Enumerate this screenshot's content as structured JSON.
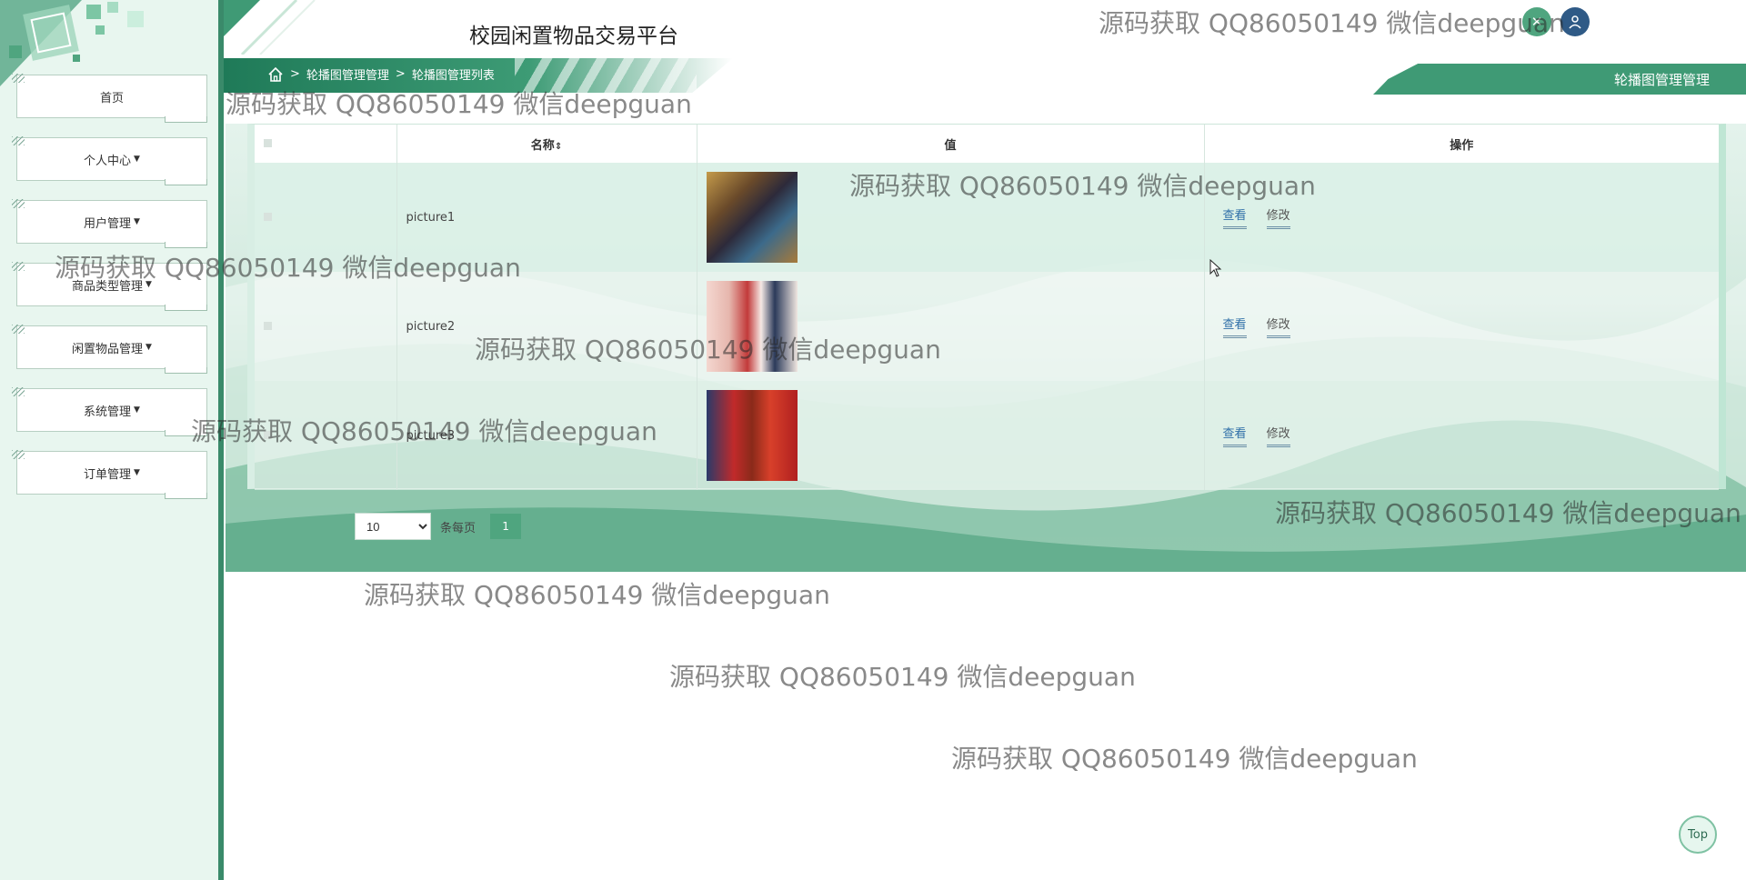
{
  "app": {
    "title": "校园闲置物品交易平台"
  },
  "sidebar": {
    "items": [
      {
        "label": "首页",
        "has_caret": false
      },
      {
        "label": "个人中心",
        "has_caret": true
      },
      {
        "label": "用户管理",
        "has_caret": true
      },
      {
        "label": "商品类型管理",
        "has_caret": true
      },
      {
        "label": "闲置物品管理",
        "has_caret": true
      },
      {
        "label": "系统管理",
        "has_caret": true
      },
      {
        "label": "订单管理",
        "has_caret": true
      }
    ]
  },
  "header": {
    "breadcrumb": {
      "sep1": ">",
      "level1": "轮播图管理管理",
      "sep2": ">",
      "level2": "轮播图管理列表"
    },
    "page_flag": "轮播图管理管理"
  },
  "table": {
    "columns": {
      "name": "名称",
      "value": "值",
      "actions": "操作"
    },
    "sort_icon": "sort-icon",
    "rows": [
      {
        "name": "picture1",
        "view": "查看",
        "edit": "修改"
      },
      {
        "name": "picture2",
        "view": "查看",
        "edit": "修改"
      },
      {
        "name": "picture3",
        "view": "查看",
        "edit": "修改"
      }
    ]
  },
  "pagination": {
    "page_size": "10",
    "page_size_options": [
      "10"
    ],
    "per_page_label": "条每页",
    "current_page": "1"
  },
  "top_button": "Top",
  "watermark": "源码获取 QQ86050149 微信deepguan",
  "colors": {
    "accent": "#3f9a75",
    "sidebar_bg": "#e8f6ef",
    "link": "#2f6fa8"
  }
}
